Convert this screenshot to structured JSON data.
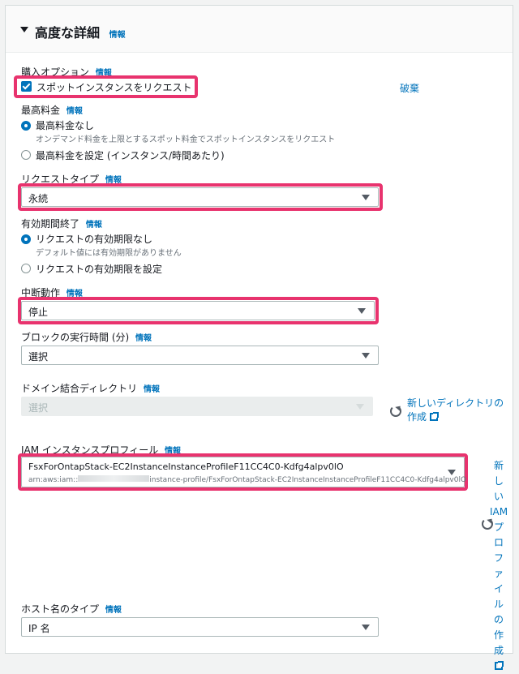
{
  "section": {
    "title": "高度な詳細",
    "info": "情報"
  },
  "purchase": {
    "label": "購入オプション",
    "info": "情報",
    "checkbox_label": "スポットインスタンスをリクエスト",
    "discard": "破棄"
  },
  "max_price": {
    "label": "最高料金",
    "info": "情報",
    "opt1_label": "最高料金なし",
    "opt1_desc": "オンデマンド料金を上限とするスポット料金でスポットインスタンスをリクエスト",
    "opt2_label": "最高料金を設定 (インスタンス/時間あたり)"
  },
  "request_type": {
    "label": "リクエストタイプ",
    "info": "情報",
    "value": "永続"
  },
  "expiry": {
    "label": "有効期間終了",
    "info": "情報",
    "opt1_label": "リクエストの有効期限なし",
    "opt1_desc": "デフォルト値には有効期限がありません",
    "opt2_label": "リクエストの有効期限を設定"
  },
  "interruption": {
    "label": "中断動作",
    "info": "情報",
    "value": "停止"
  },
  "block_duration": {
    "label": "ブロックの実行時間 (分)",
    "info": "情報",
    "value": "選択"
  },
  "domain_join": {
    "label": "ドメイン結合ディレクトリ",
    "info": "情報",
    "value": "選択",
    "new_link_line1": "新しいディレクトリの",
    "new_link_line2": "作成"
  },
  "iam": {
    "label": "IAM インスタンスプロフィール",
    "info": "情報",
    "value": "FsxForOntapStack-EC2InstanceInstanceProfileF11CC4C0-Kdfg4alpv0lO",
    "arn_prefix": "arn:aws:iam::",
    "arn_suffix": "instance-profile/FsxForOntapStack-EC2InstanceInstanceProfileF11CC4C0-Kdfg4alpv0lO",
    "new_link_chars": [
      "新し",
      "い",
      "IAM",
      "プロ",
      "ファ",
      "イル",
      "の作",
      "成"
    ]
  },
  "hostname": {
    "label": "ホスト名のタイプ",
    "info": "情報",
    "value": "IP 名"
  },
  "colors": {
    "accent": "#0073bb",
    "highlight": "#e8336e"
  }
}
